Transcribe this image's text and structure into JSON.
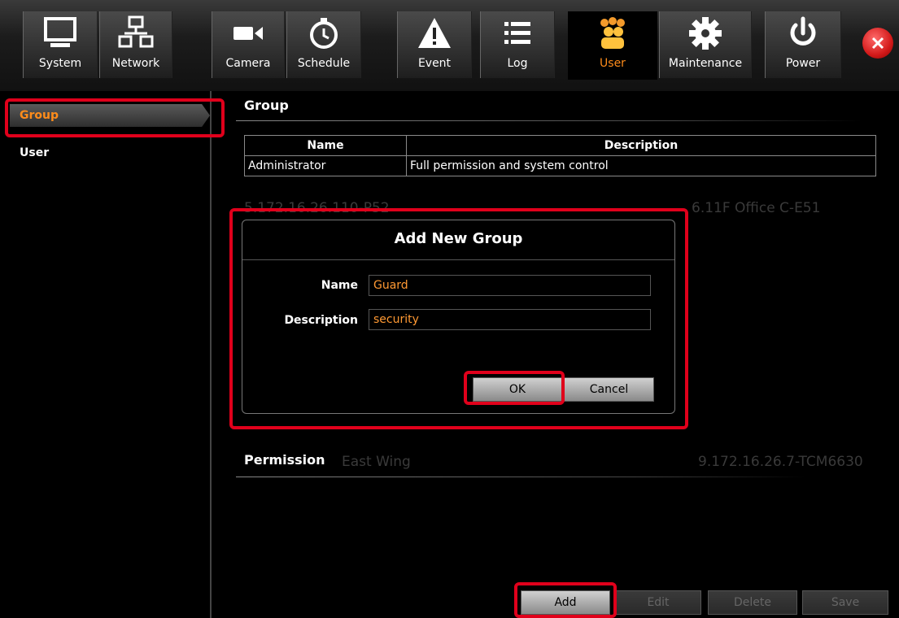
{
  "toolbar": {
    "tabs": [
      {
        "label": "System",
        "icon": "monitor-icon"
      },
      {
        "label": "Network",
        "icon": "network-icon"
      },
      {
        "label": "Camera",
        "icon": "camera-icon"
      },
      {
        "label": "Schedule",
        "icon": "clock-icon"
      },
      {
        "label": "Event",
        "icon": "warning-icon"
      },
      {
        "label": "Log",
        "icon": "list-icon"
      },
      {
        "label": "User",
        "icon": "users-icon",
        "active": true
      },
      {
        "label": "Maintenance",
        "icon": "gear-icon"
      },
      {
        "label": "Power",
        "icon": "power-icon"
      }
    ],
    "close_icon": "close-icon"
  },
  "sidebar": {
    "items": [
      {
        "label": "Group",
        "selected": true
      },
      {
        "label": "User",
        "selected": false
      }
    ]
  },
  "main": {
    "group_title": "Group",
    "table": {
      "headers": [
        "Name",
        "Description"
      ],
      "rows": [
        [
          "Administrator",
          "Full permission and system control"
        ]
      ]
    },
    "permission_title": "Permission",
    "background_text": [
      "5.172.16.26.110-P52",
      "6.11F Office C-E51",
      "East Wing",
      "9.172.16.26.7-TCM6630"
    ]
  },
  "dialog": {
    "title": "Add New Group",
    "name_label": "Name",
    "name_value": "Guard",
    "description_label": "Description",
    "description_value": "security",
    "ok_label": "OK",
    "cancel_label": "Cancel"
  },
  "bottom_buttons": {
    "add": "Add",
    "edit": "Edit",
    "delete": "Delete",
    "save": "Save"
  },
  "colors": {
    "accent": "#ff8c1a",
    "highlight": "#e0001b",
    "input_text": "#ff9933"
  }
}
